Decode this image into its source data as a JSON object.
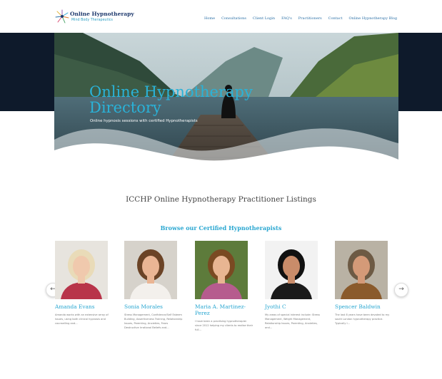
{
  "brand": {
    "title": "Online Hypnotherapy",
    "subtitle": "Mind Body Therapeutics"
  },
  "nav": [
    "Home",
    "Consultations",
    "Client Login",
    "FAQ's",
    "Practitioners",
    "Contact",
    "Online Hypnotherapy Blog"
  ],
  "hero": {
    "title_line1": "Online Hypnotherapy",
    "title_line2": "Directory",
    "subtitle": "Online hypnosis sessions with certified Hypnotherapists"
  },
  "listings_title": "ICCHP Online Hypnotherapy Practitioner Listings",
  "browse_title": "Browse our Certified Hypnotherapists",
  "carousel": {
    "prev_icon": "chevron-left-icon",
    "next_icon": "chevron-right-icon",
    "prev_glyph": "←",
    "next_glyph": "→"
  },
  "practitioners": [
    {
      "name": "Amanda Evans",
      "bio": "Amanda works with an extensive array of issues, using both clinical hypnosis and counselling and...",
      "bg": "#e7e4de",
      "hair": "#e9dbb8",
      "skin": "#f0c9ad",
      "top": "#b8344a"
    },
    {
      "name": "Sonia Morales",
      "bio": "Stress Management, Confidence/Self Esteem Building, Assertiveness Training, Relationship Issues, Parenting, Anxieties, Fears Destructive Irrational Beliefs and...",
      "bg": "#d6d2cb",
      "hair": "#6b4326",
      "skin": "#eab594",
      "top": "#f3f0ec"
    },
    {
      "name": "Maria A. Martinez-Perez",
      "bio": "I have been a practising hypnotherapist since 2012 helping my clients to realise their full...",
      "bg": "#5d7b3b",
      "hair": "#7a4a22",
      "skin": "#e8b592",
      "top": "#b65c8e"
    },
    {
      "name": "Jyothi C",
      "bio": "My areas of special interest include: Stress Management, Weight Management, Relationship Issues, Parenting, Anxieties, and...",
      "bg": "#f2f2f2",
      "hair": "#111111",
      "skin": "#c98c6a",
      "top": "#1a1a1a"
    },
    {
      "name": "Spencer Baldwin",
      "bio": "The last 8 years have been devoted to my south London hypnotherapy practice. Typically I...",
      "bg": "#b9b2a4",
      "hair": "#6d5a44",
      "skin": "#d49a78",
      "top": "#8a5a2b"
    }
  ]
}
